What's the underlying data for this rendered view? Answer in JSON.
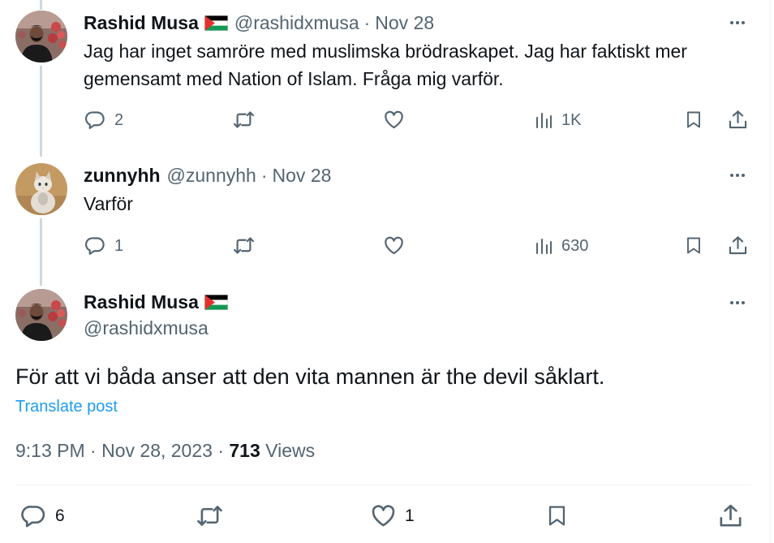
{
  "tweets": [
    {
      "display_name": "Rashid Musa",
      "handle": "@rashidxmusa",
      "separator": "·",
      "date": "Nov 28",
      "text_line1": "Jag har inget samröre med muslimska brödraskapet. Jag har faktiskt mer",
      "text_line2": "gemensamt med Nation of Islam. Fråga mig varför.",
      "reply_count": "2",
      "retweet_count": "",
      "like_count": "",
      "view_count": "1K"
    },
    {
      "display_name": "zunnyhh",
      "handle": "@zunnyhh",
      "separator": "·",
      "date": "Nov 28",
      "text_line1": "Varför",
      "reply_count": "1",
      "retweet_count": "",
      "like_count": "",
      "view_count": "630"
    }
  ],
  "main_tweet": {
    "display_name": "Rashid Musa",
    "handle": "@rashidxmusa",
    "text": "För att vi båda anser att den vita mannen är the devil såklart.",
    "translate_label": "Translate post",
    "time": "9:13 PM",
    "separator": "·",
    "date": "Nov 28, 2023",
    "separator2": "·",
    "views_count": "713",
    "views_label": "Views",
    "reply_count": "6",
    "retweet_count": "",
    "like_count": "1"
  },
  "icons": [
    "reply-icon",
    "retweet-icon",
    "like-icon",
    "views-icon",
    "bookmark-icon",
    "share-icon",
    "more-icon",
    "palestine-flag-icon"
  ],
  "colors": {
    "text": "#0f1419",
    "secondary": "#536471",
    "link": "#1d9bf0",
    "thread_line": "#cfd9de",
    "divider": "#eff3f4"
  }
}
